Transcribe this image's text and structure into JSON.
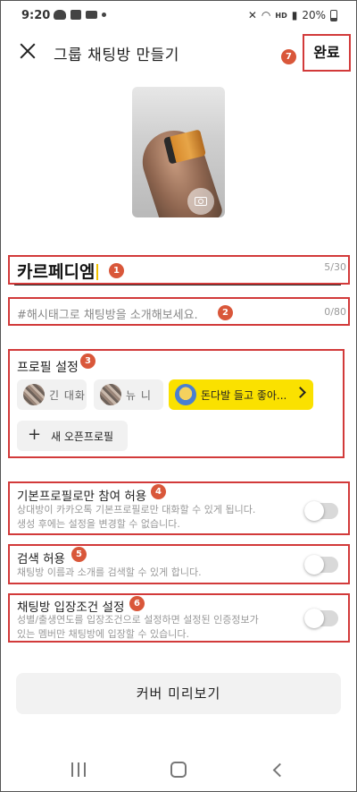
{
  "status_bar": {
    "time": "9:20",
    "hd_label": "HD",
    "battery_text": "20%"
  },
  "header": {
    "title": "그룹 채팅방 만들기",
    "done_label": "완료"
  },
  "annotation_badges": [
    "1",
    "2",
    "3",
    "4",
    "5",
    "6",
    "7"
  ],
  "name_field": {
    "value": "카르페디엠",
    "counter": "5/30"
  },
  "hashtag_field": {
    "placeholder": "#해시태그로 채팅방을 소개해보세요.",
    "counter": "0/80"
  },
  "profile_section": {
    "title": "프로필 설정",
    "profiles": [
      {
        "name": "긴 대화",
        "selected": false
      },
      {
        "name": "뉴 니",
        "selected": false
      },
      {
        "name": "돈다발 들고 좋아...",
        "selected": true
      }
    ],
    "new_profile_label": "새 오픈프로필"
  },
  "settings": [
    {
      "title": "기본프로필로만 참여 허용",
      "description_lines": [
        "상대방이 카카오톡 기본프로필로만 대화할 수 있게 됩니다.",
        "생성 후에는 설정을 변경할 수 없습니다."
      ],
      "enabled": false
    },
    {
      "title": "검색 허용",
      "description_lines": [
        "채팅방 이름과 소개를 검색할 수 있게 합니다."
      ],
      "enabled": false
    },
    {
      "title": "채팅방 입장조건 설정",
      "description_lines": [
        "성별/출생연도를 입장조건으로 설정하면 설정된 인증정보가",
        "있는 멤버만 채팅방에 입장할 수 있습니다."
      ],
      "enabled": false
    }
  ],
  "preview_button_label": "커버 미리보기",
  "colors": {
    "annotation_red": "#d23a3a",
    "badge": "#d9573a",
    "kakao_yellow": "#fae100"
  }
}
